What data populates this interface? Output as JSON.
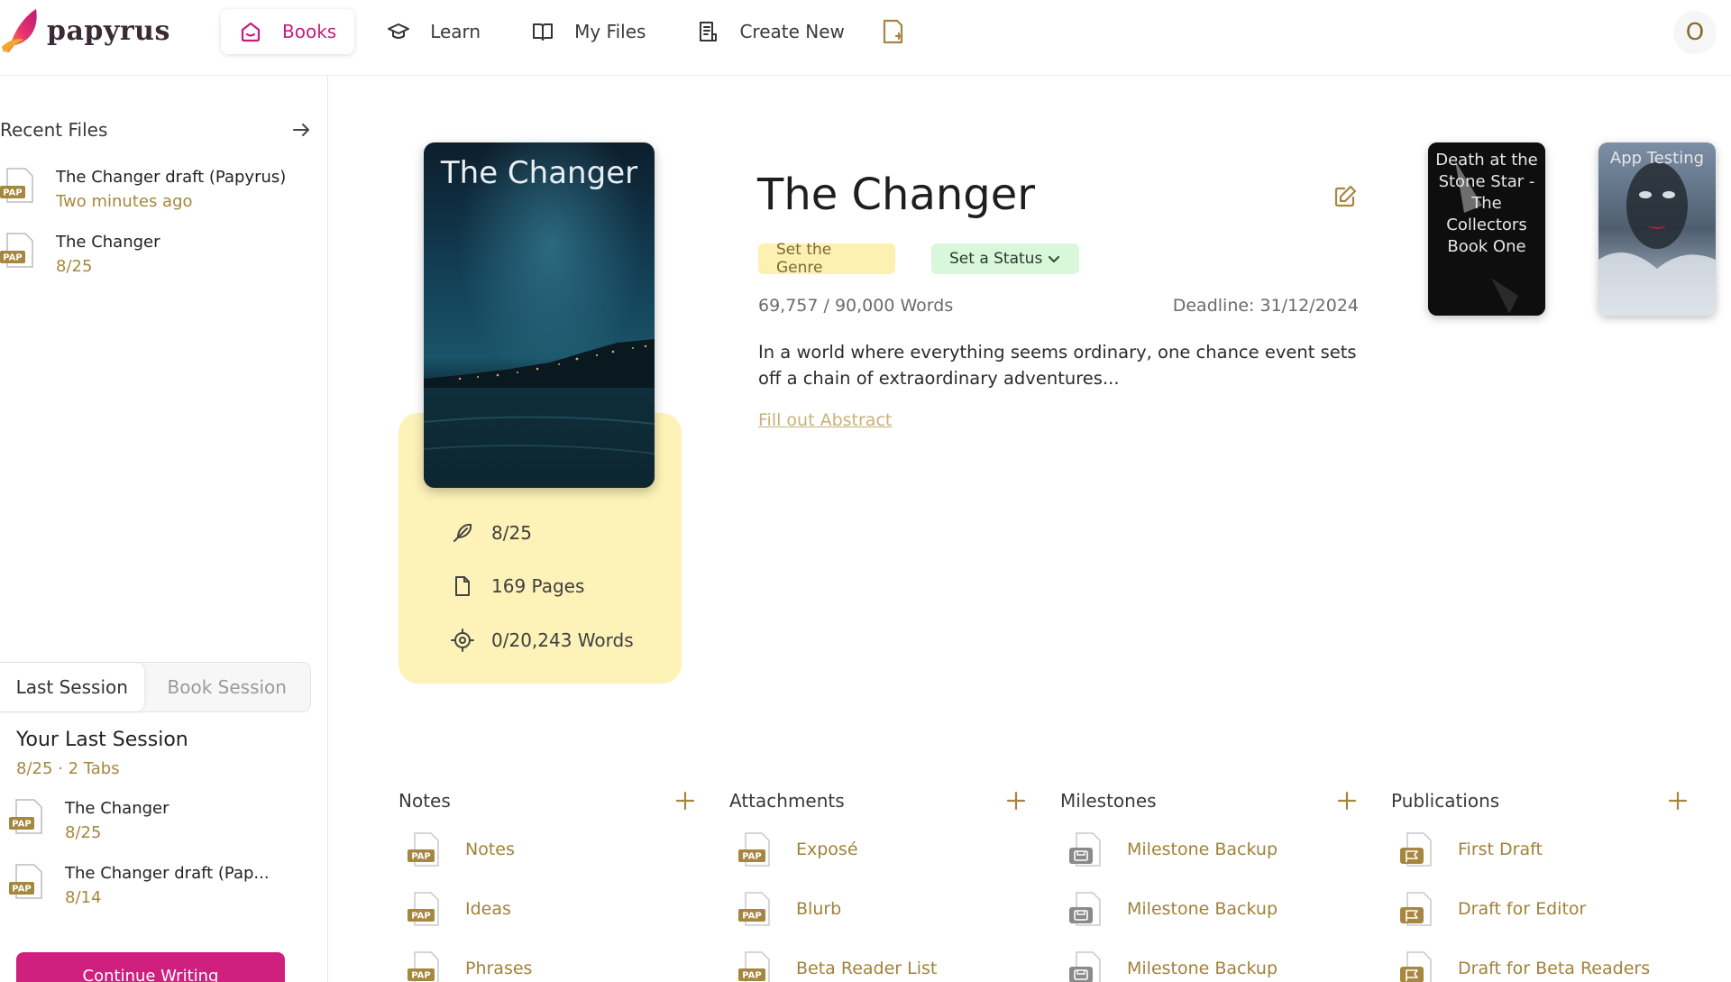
{
  "brand": {
    "name": "papyrus"
  },
  "nav": {
    "items": [
      {
        "label": "Books",
        "icon": "home-icon"
      },
      {
        "label": "Learn",
        "icon": "graduation-cap-icon"
      },
      {
        "label": "My Files",
        "icon": "open-book-icon"
      },
      {
        "label": "Create New",
        "icon": "document-list-icon"
      }
    ],
    "extra_icon": "add-document-icon",
    "avatar_initial": "O"
  },
  "sidebar": {
    "recent_title": "Recent Files",
    "recent_files": [
      {
        "title": "The Changer draft (Papyrus)",
        "sub": "Two minutes ago",
        "badge": "PAP"
      },
      {
        "title": "The Changer",
        "sub": "8/25",
        "badge": "PAP"
      }
    ],
    "tabs": [
      "Last Session",
      "Book Session"
    ],
    "session_title": "Your Last Session",
    "session_sub": "8/25 · 2 Tabs",
    "session_files": [
      {
        "title": "The Changer",
        "sub": "8/25",
        "badge": "PAP"
      },
      {
        "title": "The Changer draft (Pap...",
        "sub": "8/14",
        "badge": "PAP"
      }
    ],
    "continue_label": "Continue Writing"
  },
  "book": {
    "cover_title": "The Changer",
    "title": "The Changer",
    "genre_label": "Set the Genre",
    "status_label": "Set a Status",
    "word_count": "69,757 / 90,000 Words",
    "deadline": "Deadline: 31/12/2024",
    "description": "In a world where everything seems ordinary, one chance event sets off a chain of extraordinary adventures...",
    "abstract_link": "Fill out Abstract",
    "stats": [
      {
        "icon": "feather-icon",
        "value": "8/25"
      },
      {
        "icon": "page-icon",
        "value": "169 Pages"
      },
      {
        "icon": "target-icon",
        "value": "0/20,243 Words"
      }
    ]
  },
  "other_books": [
    {
      "title": "Death at the Stone Star - The Collectors Book One"
    },
    {
      "title": "App Testing"
    }
  ],
  "sections": [
    {
      "title": "Notes",
      "items": [
        "Notes",
        "Ideas",
        "Phrases"
      ],
      "badge": "PAP"
    },
    {
      "title": "Attachments",
      "items": [
        "Exposé",
        "Blurb",
        "Beta Reader List"
      ],
      "badge": "PAP"
    },
    {
      "title": "Milestones",
      "items": [
        "Milestone Backup",
        "Milestone Backup",
        "Milestone Backup"
      ]
    },
    {
      "title": "Publications",
      "items": [
        "First Draft",
        "Draft for Editor",
        "Draft for Beta Readers"
      ]
    }
  ],
  "colors": {
    "accent": "#cf1f7f",
    "gold": "#a5873f",
    "card": "#fdf2b8",
    "status": "#d8f7db"
  }
}
